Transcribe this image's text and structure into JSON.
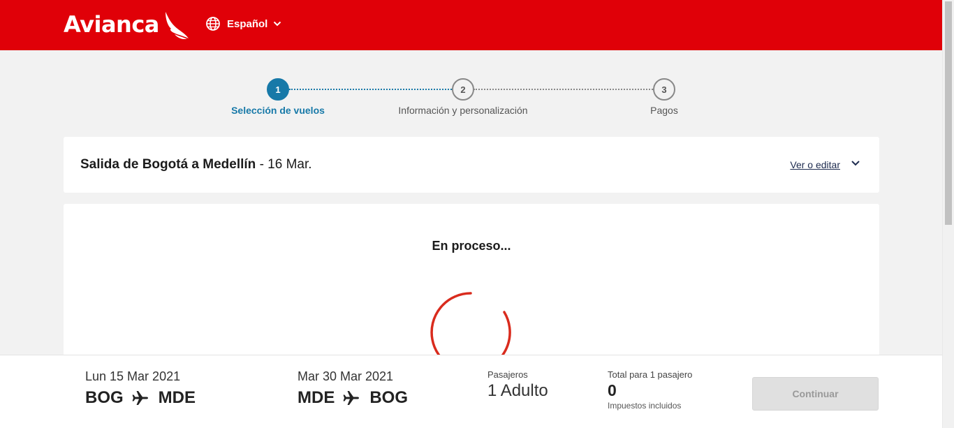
{
  "header": {
    "brand": "Avianca",
    "language": "Español"
  },
  "stepper": {
    "steps": [
      {
        "number": "1",
        "label": "Selección de vuelos",
        "active": true
      },
      {
        "number": "2",
        "label": "Información y personalización",
        "active": false
      },
      {
        "number": "3",
        "label": "Pagos",
        "active": false
      }
    ]
  },
  "route": {
    "title": "Salida de Bogotá a Medellín",
    "date": "- 16 Mar.",
    "edit_label": "Ver o editar"
  },
  "main": {
    "status": "En proceso..."
  },
  "footer": {
    "outbound": {
      "date": "Lun 15 Mar 2021",
      "from": "BOG",
      "to": "MDE"
    },
    "return": {
      "date": "Mar 30 Mar 2021",
      "from": "MDE",
      "to": "BOG"
    },
    "passengers_label": "Pasajeros",
    "passengers_value": "1 Adulto",
    "total_label": "Total para 1 pasajero",
    "total_value": "0",
    "total_note": "Impuestos incluidos",
    "continue_label": "Continuar"
  },
  "colors": {
    "brand_red": "#e00008",
    "step_active": "#1779a8",
    "spinner": "#d92b1d"
  }
}
